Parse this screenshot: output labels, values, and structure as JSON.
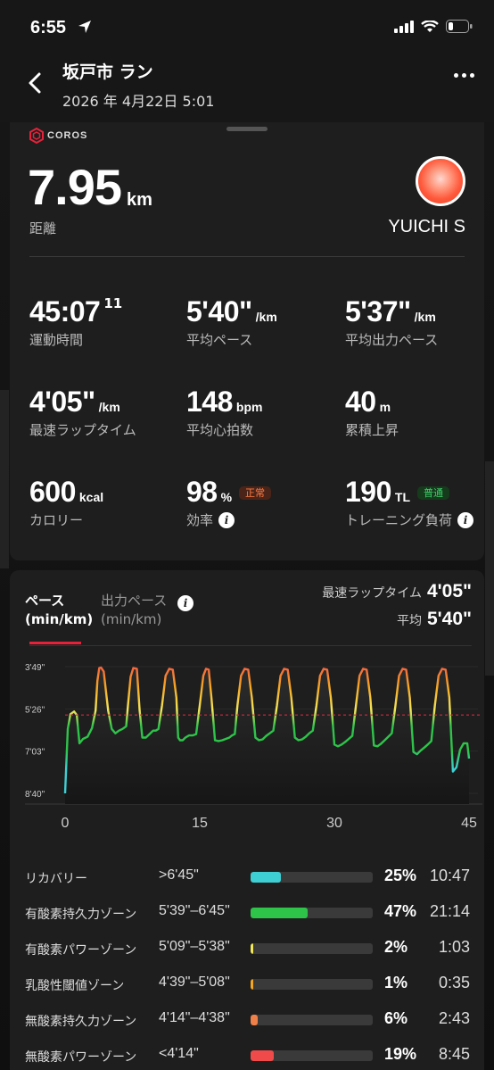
{
  "status_bar": {
    "time": "6:55"
  },
  "header": {
    "title": "坂戸市 ラン",
    "subtitle": "2026 年 4月22日 5:01"
  },
  "summary_card": {
    "brand": "COROS",
    "distance": {
      "value": "7.95",
      "unit": "km",
      "label": "距離"
    },
    "user_name": "YUICHI S",
    "stats": [
      {
        "value": "45:07",
        "sup": "11",
        "unit": "",
        "label": "運動時間"
      },
      {
        "value": "5'40\"",
        "unit": "/km",
        "label": "平均ペース"
      },
      {
        "value": "5'37\"",
        "unit": "/km",
        "label": "平均出力ペース"
      },
      {
        "value": "4'05\"",
        "unit": "/km",
        "label": "最速ラップタイム"
      },
      {
        "value": "148",
        "unit": "bpm",
        "label": "平均心拍数"
      },
      {
        "value": "40",
        "unit": "m",
        "label": "累積上昇"
      },
      {
        "value": "600",
        "unit": "kcal",
        "label": "カロリー"
      },
      {
        "value": "98",
        "unit": "%",
        "label": "効率",
        "badge": "正常"
      },
      {
        "value": "190",
        "unit": "TL",
        "label": "トレーニング負荷",
        "badge": "普通"
      }
    ]
  },
  "pace_card": {
    "tabs": [
      {
        "label": "ペース",
        "sublabel": "(min/km)"
      },
      {
        "label": "出力ペース",
        "sublabel": "(min/km)"
      }
    ],
    "fastest_lap_label": "最速ラップタイム",
    "fastest_lap_value": "4'05\"",
    "avg_label": "平均",
    "avg_value": "5'40\""
  },
  "chart_data": {
    "type": "line",
    "y_ticks": [
      "3'49\"",
      "5'26\"",
      "7'03\"",
      "8'40\""
    ],
    "x_ticks": [
      "0",
      "15",
      "30",
      "45"
    ],
    "xlim": [
      0,
      45
    ],
    "ylim_seconds": [
      229,
      520
    ],
    "average_line_seconds": 340,
    "x": [
      0,
      0.3,
      0.6,
      1.0,
      1.3,
      1.6,
      2.0,
      2.5,
      3.0,
      3.4,
      3.6,
      3.8,
      4.0,
      4.3,
      4.8,
      5.2,
      5.6,
      6.0,
      6.4,
      6.8,
      7.0,
      7.3,
      7.6,
      8.0,
      8.3,
      8.6,
      9.0,
      9.5,
      9.8,
      10.1,
      10.4,
      10.8,
      11.2,
      11.6,
      12.0,
      12.4,
      12.6,
      12.8,
      13.1,
      13.4,
      13.8,
      14.2,
      14.6,
      15.0,
      15.4,
      15.7,
      16.0,
      16.3,
      16.7,
      17.1,
      17.5,
      17.9,
      18.3,
      18.6,
      18.9,
      19.2,
      19.6,
      20.0,
      20.4,
      20.8,
      21.2,
      21.6,
      22.0,
      22.4,
      22.8,
      23.2,
      23.6,
      24.0,
      24.4,
      24.8,
      25.2,
      25.6,
      26.0,
      26.4,
      26.8,
      27.2,
      27.6,
      28.0,
      28.4,
      28.8,
      29.2,
      29.6,
      30.0,
      30.4,
      30.8,
      31.2,
      31.6,
      32.0,
      32.4,
      32.8,
      33.2,
      33.6,
      34.0,
      34.4,
      34.8,
      35.2,
      35.6,
      36.0,
      36.4,
      36.8,
      37.2,
      37.6,
      38.0,
      38.4,
      38.8,
      39.2,
      39.6,
      40.0,
      40.4,
      40.8,
      41.2,
      41.6,
      42.0,
      42.4,
      42.8,
      43.2,
      43.6,
      44.0,
      44.4,
      44.8,
      45.0
    ],
    "pace_seconds": [
      520,
      372,
      338,
      332,
      340,
      405,
      395,
      390,
      370,
      330,
      262,
      232,
      231,
      240,
      330,
      372,
      382,
      376,
      372,
      366,
      318,
      252,
      232,
      234,
      330,
      392,
      392,
      382,
      376,
      376,
      372,
      318,
      250,
      234,
      236,
      300,
      392,
      398,
      398,
      392,
      387,
      387,
      384,
      318,
      250,
      234,
      236,
      300,
      398,
      400,
      398,
      395,
      392,
      387,
      384,
      318,
      250,
      234,
      236,
      300,
      392,
      398,
      396,
      388,
      382,
      376,
      318,
      250,
      234,
      236,
      300,
      392,
      398,
      396,
      390,
      382,
      376,
      318,
      250,
      234,
      236,
      300,
      408,
      412,
      408,
      402,
      395,
      388,
      318,
      250,
      234,
      236,
      300,
      410,
      412,
      406,
      398,
      390,
      382,
      318,
      250,
      234,
      236,
      300,
      425,
      430,
      422,
      415,
      408,
      400,
      318,
      250,
      234,
      236,
      300,
      470,
      460,
      420,
      405,
      405,
      440,
      470
    ]
  },
  "zones": [
    {
      "name": "リカバリー",
      "range": ">6'45\"",
      "percent": "25%",
      "fraction": 0.25,
      "time": "10:47",
      "color": "#3ecfd4"
    },
    {
      "name": "有酸素持久力ゾーン",
      "range": "5'39\"–6'45\"",
      "percent": "47%",
      "fraction": 0.47,
      "time": "21:14",
      "color": "#2ec44a"
    },
    {
      "name": "有酸素パワーゾーン",
      "range": "5'09\"–5'38\"",
      "percent": "2%",
      "fraction": 0.02,
      "time": "1:03",
      "color": "#f2e85a"
    },
    {
      "name": "乳酸性閾値ゾーン",
      "range": "4'39\"–5'08\"",
      "percent": "1%",
      "fraction": 0.01,
      "time": "0:35",
      "color": "#f5a623"
    },
    {
      "name": "無酸素持久力ゾーン",
      "range": "4'14\"–4'38\"",
      "percent": "6%",
      "fraction": 0.06,
      "time": "2:43",
      "color": "#f0804a"
    },
    {
      "name": "無酸素パワーゾーン",
      "range": "<4'14\"",
      "percent": "19%",
      "fraction": 0.19,
      "time": "8:45",
      "color": "#f04a4a"
    }
  ]
}
